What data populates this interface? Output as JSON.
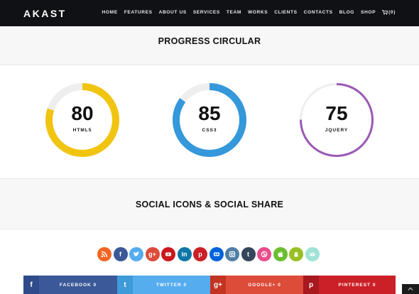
{
  "header": {
    "logo": "AKAST",
    "nav": [
      "HOME",
      "FEATURES",
      "ABOUT US",
      "SERVICES",
      "TEAM",
      "WORKS",
      "CLIENTS",
      "CONTACTS",
      "BLOG",
      "SHOP"
    ],
    "cart": "(0)"
  },
  "sections": {
    "progress_title": "PROGRESS CIRCULAR",
    "social_title": "SOCIAL ICONS & SOCIAL SHARE"
  },
  "progress": [
    {
      "value": 80,
      "value_text": "80",
      "label": "HTML5",
      "color": "#f1c40f",
      "track": "#eeeeee",
      "style": "thick"
    },
    {
      "value": 85,
      "value_text": "85",
      "label": "CSS3",
      "color": "#3498db",
      "track": "#eeeeee",
      "style": "thick"
    },
    {
      "value": 75,
      "value_text": "75",
      "label": "JQUERY",
      "color": "#9b59b6",
      "track": "#eeeeee",
      "style": "thin"
    }
  ],
  "social_icons": [
    {
      "name": "rss-icon",
      "color": "#f26522"
    },
    {
      "name": "facebook-icon",
      "color": "#3b5998"
    },
    {
      "name": "twitter-icon",
      "color": "#55acee"
    },
    {
      "name": "google-plus-icon",
      "color": "#dd4b39"
    },
    {
      "name": "youtube-icon",
      "color": "#cc181e"
    },
    {
      "name": "linkedin-icon",
      "color": "#0e76a8"
    },
    {
      "name": "pinterest-icon",
      "color": "#cb2027"
    },
    {
      "name": "flickr-icon",
      "color": "#0063dc"
    },
    {
      "name": "instagram-icon",
      "color": "#517fa4"
    },
    {
      "name": "tumblr-icon",
      "color": "#35465c"
    },
    {
      "name": "dribbble-icon",
      "color": "#ea4c89"
    },
    {
      "name": "apple-icon",
      "color": "#6bbf2f"
    },
    {
      "name": "android-icon",
      "color": "#97c024"
    },
    {
      "name": "email-icon",
      "color": "#9ee3d6"
    }
  ],
  "share": [
    {
      "icon": "f",
      "label": "FACEBOOK 0",
      "icon_color": "#2f4b8a",
      "color": "#3b5998"
    },
    {
      "icon": "t",
      "label": "TWITTER 0",
      "icon_color": "#3e9ad8",
      "color": "#55acee"
    },
    {
      "icon": "g+",
      "label": "GOOGLE+ 0",
      "icon_color": "#c23321",
      "color": "#dd4b39"
    },
    {
      "icon": "p",
      "label": "PINTEREST 0",
      "icon_color": "#a8181f",
      "color": "#cb2027"
    }
  ]
}
